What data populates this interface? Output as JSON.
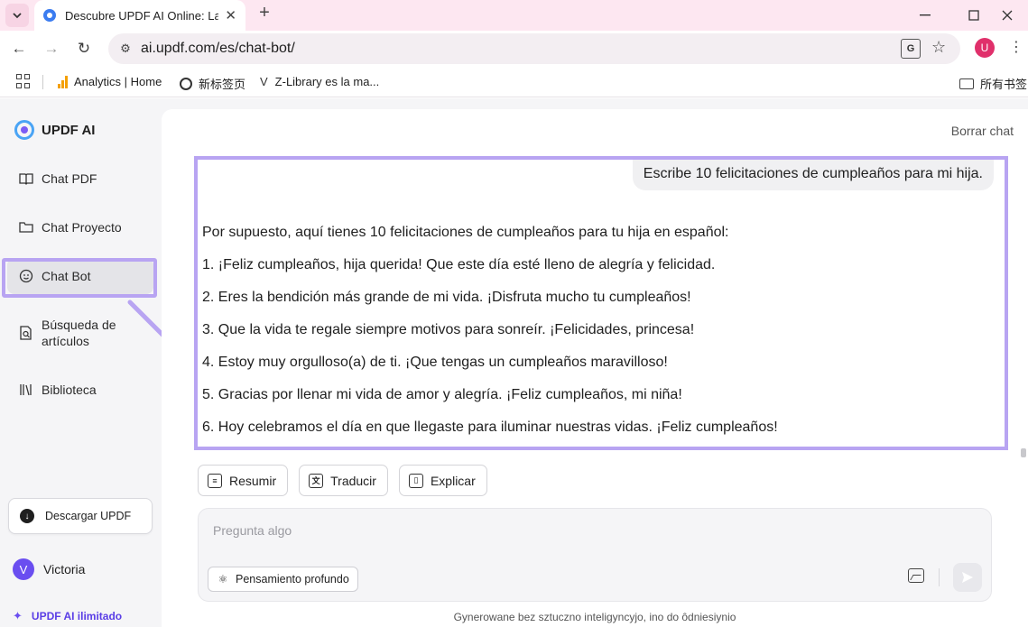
{
  "browser": {
    "tab_title": "Descubre UPDF AI Online: La",
    "url": "ai.updf.com/es/chat-bot/",
    "profile_initial": "U",
    "bookmarks": [
      {
        "label": "Analytics | Home"
      },
      {
        "label": "新标签页"
      },
      {
        "label": "Z-Library es la ma..."
      }
    ],
    "all_bookmarks": "所有书签"
  },
  "sidebar": {
    "logo": "UPDF AI",
    "items": [
      {
        "label": "Chat PDF"
      },
      {
        "label": "Chat Proyecto"
      },
      {
        "label": "Chat Bot"
      },
      {
        "label": "Búsqueda de artículos"
      },
      {
        "label": "Biblioteca"
      }
    ],
    "download_label": "Descargar UPDF",
    "user_initial": "V",
    "user_name": "Victoria",
    "unlimited_label": "UPDF AI ilimitado"
  },
  "main": {
    "clear_chat": "Borrar chat",
    "user_message": "Escribe 10 felicitaciones de cumpleaños para mi hija.",
    "reply_lines": [
      "Por supuesto, aquí tienes 10 felicitaciones de cumpleaños para tu hija en español:",
      "1.  ¡Feliz cumpleaños, hija querida! Que este día esté lleno de alegría y felicidad.",
      "2. Eres la bendición más grande de mi vida. ¡Disfruta mucho tu cumpleaños!",
      "3. Que la vida te regale siempre motivos para sonreír. ¡Felicidades, princesa!",
      "4. Estoy muy orgulloso(a) de ti. ¡Que tengas un cumpleaños maravilloso!",
      "5. Gracias por llenar mi vida de amor y alegría. ¡Feliz cumpleaños, mi niña!",
      "6. Hoy celebramos el día en que llegaste para iluminar nuestras vidas. ¡Feliz cumpleaños!"
    ],
    "actions": [
      {
        "label": "Resumir"
      },
      {
        "label": "Traducir"
      },
      {
        "label": "Explicar"
      }
    ],
    "input_placeholder": "Pregunta algo",
    "deep_think_label": "Pensamiento profundo",
    "footer_note": "Gynerowane bez sztuczno inteligyncyjo, ino do ôdniesiynio"
  },
  "colors": {
    "highlight": "#b8a4f2",
    "accent": "#6a4ef0",
    "tabbar": "#fde7f1"
  }
}
